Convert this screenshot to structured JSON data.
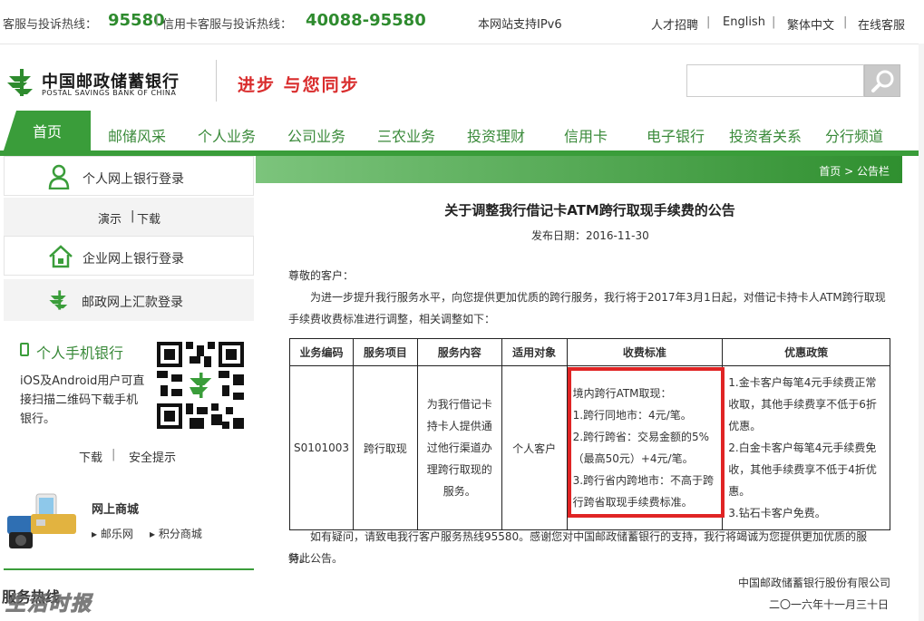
{
  "topbar": {
    "hotline_label": "客服与投诉热线：",
    "hotline_number": "95580",
    "separator": "|",
    "credit_label": "信用卡客服与投诉热线：",
    "credit_number": "40088-95580",
    "ipv6": "本网站支持IPv6",
    "links": [
      "人才招聘",
      "English",
      "繁体中文",
      "在线客服"
    ]
  },
  "header": {
    "logo_cn": "中国邮政储蓄银行",
    "logo_en": "POSTAL SAVINGS BANK OF CHINA",
    "slogan": "进步 与您同步",
    "search_placeholder": ""
  },
  "nav": {
    "items": [
      "首页",
      "邮储风采",
      "个人业务",
      "公司业务",
      "三农业务",
      "投资理财",
      "信用卡",
      "电子银行",
      "投资者关系",
      "分行频道"
    ]
  },
  "sidebar": {
    "personal_login": "个人网上银行登录",
    "demo": "演示",
    "download": "下载",
    "pipe": "|",
    "corporate_login": "企业网上银行登录",
    "remit_login": "邮政网上汇款登录",
    "mobile_title": "个人手机银行",
    "mobile_desc": "iOS及Android用户可直接扫描二维码下载手机银行。",
    "mobile_download": "下载",
    "mobile_security": "安全提示",
    "mall_title": "网上商城",
    "mall_links": [
      "邮乐网",
      "积分商城"
    ],
    "bottom_heading": "服务热线",
    "watermark": "生活时报"
  },
  "breadcrumb": {
    "home": "首页",
    "arrow": ">",
    "current": "公告栏"
  },
  "article": {
    "title": "关于调整我行借记卡ATM跨行取现手续费的公告",
    "date": "发布日期：2016-11-30",
    "greeting": "尊敬的客户：",
    "intro": "为进一步提升我行服务水平，向您提供更加优质的跨行服务，我行将于2017年3月1日起，对借记卡持卡人ATM跨行取现手续费收费标准进行调整，相关调整如下：",
    "table": {
      "headers": [
        "业务编码",
        "服务项目",
        "服务内容",
        "适用对象",
        "收费标准",
        "优惠政策"
      ],
      "row": {
        "code": "S0101003",
        "item": "跨行取现",
        "content": "为我行借记卡持卡人提供通过他行渠道办理跨行取现的服务。",
        "target": "个人客户",
        "fee_lines": [
          "境内跨行ATM取现：",
          "1.跨行同地市：4元/笔。",
          "2.跨行跨省：交易金额的5%（最高50元）+4元/笔。",
          "3.跨行省内跨地市：不高于跨行跨省取现手续费标准。"
        ],
        "discount_lines": [
          "1.金卡客户每笔4元手续费正常收取，其他手续费享不低于6折优惠。",
          "2.白金卡客户每笔4元手续费免收，其他手续费享不低于4折优惠。",
          "3.钻石卡客户免费。"
        ]
      }
    },
    "closing": "如有疑问，请致电我行客户服务热线95580。感谢您对中国邮政储蓄银行的支持，我行将竭诚为您提供更加优质的服务。",
    "notice": "特此公告。",
    "signature": "中国邮政储蓄银行股份有限公司",
    "sign_date": "二〇一六年十一月三十日"
  },
  "colors": {
    "brand_green": "#3a9d3a",
    "number_green": "#2e8b2e",
    "slogan_red": "#d92c2c",
    "highlight_red": "#e02424"
  }
}
